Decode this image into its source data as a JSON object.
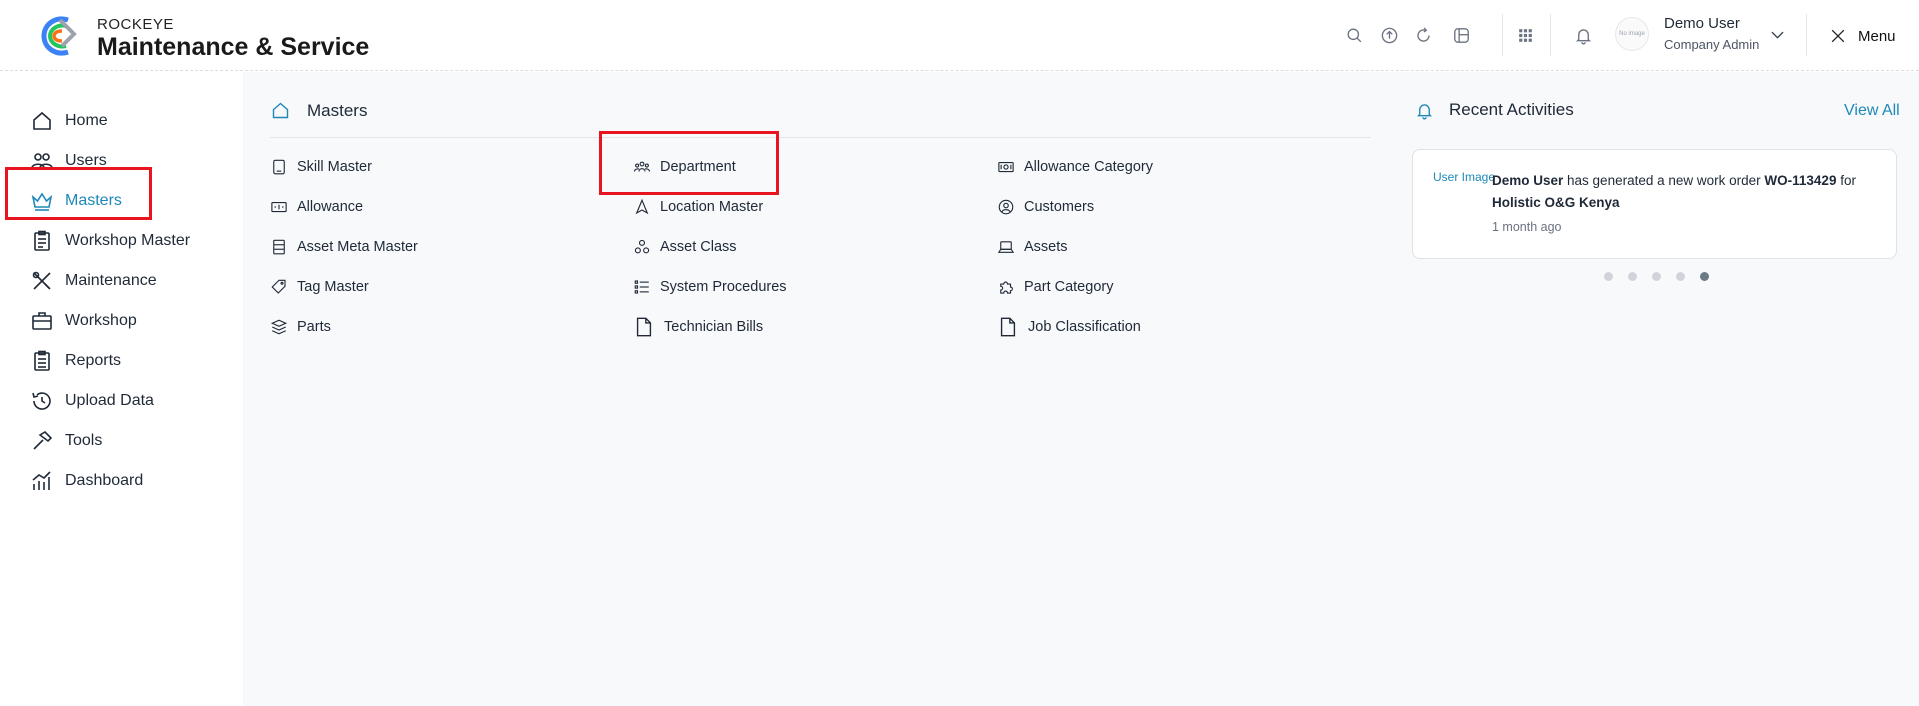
{
  "header": {
    "brand_top": "ROCKEYE",
    "brand_main": "Maintenance & Service",
    "user_name": "Demo User",
    "user_role": "Company Admin",
    "avatar_text": "No image",
    "menu_label": "Menu"
  },
  "sidebar": {
    "items": [
      {
        "label": "Home",
        "icon": "home-icon"
      },
      {
        "label": "Users",
        "icon": "users-icon"
      },
      {
        "label": "Masters",
        "icon": "crown-icon",
        "active": true
      },
      {
        "label": "Workshop Master",
        "icon": "clipboard-icon"
      },
      {
        "label": "Maintenance",
        "icon": "tools-icon"
      },
      {
        "label": "Workshop",
        "icon": "briefcase-icon"
      },
      {
        "label": "Reports",
        "icon": "report-icon"
      },
      {
        "label": "Upload Data",
        "icon": "history-icon"
      },
      {
        "label": "Tools",
        "icon": "hammer-icon"
      },
      {
        "label": "Dashboard",
        "icon": "chart-icon"
      }
    ]
  },
  "main": {
    "title": "Masters",
    "columns": [
      [
        {
          "label": "Skill Master",
          "icon": "tablet-icon"
        },
        {
          "label": "Allowance",
          "icon": "money-icon"
        },
        {
          "label": "Asset Meta Master",
          "icon": "layers-box-icon"
        },
        {
          "label": "Tag Master",
          "icon": "tag-icon"
        },
        {
          "label": "Parts",
          "icon": "stack-icon"
        }
      ],
      [
        {
          "label": "Department",
          "icon": "group-icon"
        },
        {
          "label": "Location Master",
          "icon": "navigation-icon"
        },
        {
          "label": "Asset Class",
          "icon": "circles-icon"
        },
        {
          "label": "System Procedures",
          "icon": "list-icon"
        },
        {
          "label": "Technician Bills",
          "icon": "file-icon"
        }
      ],
      [
        {
          "label": "Allowance Category",
          "icon": "cash-icon"
        },
        {
          "label": "Customers",
          "icon": "user-circle-icon"
        },
        {
          "label": "Assets",
          "icon": "laptop-icon"
        },
        {
          "label": "Part Category",
          "icon": "puzzle-icon"
        },
        {
          "label": "Job Classification",
          "icon": "file-icon"
        }
      ]
    ]
  },
  "activities": {
    "title": "Recent Activities",
    "view_all": "View All",
    "card": {
      "img_alt": "User Image",
      "user": "Demo User",
      "text": " has generated a new work order ",
      "order": "WO-113429",
      "for_text": " for ",
      "company": "Holistic O&G Kenya",
      "time": "1 month ago"
    },
    "dots_count": 5,
    "active_dot": 4
  },
  "colors": {
    "accent": "#1e88b8",
    "highlight": "#e8141f",
    "main_bg": "#f8f9fb"
  }
}
